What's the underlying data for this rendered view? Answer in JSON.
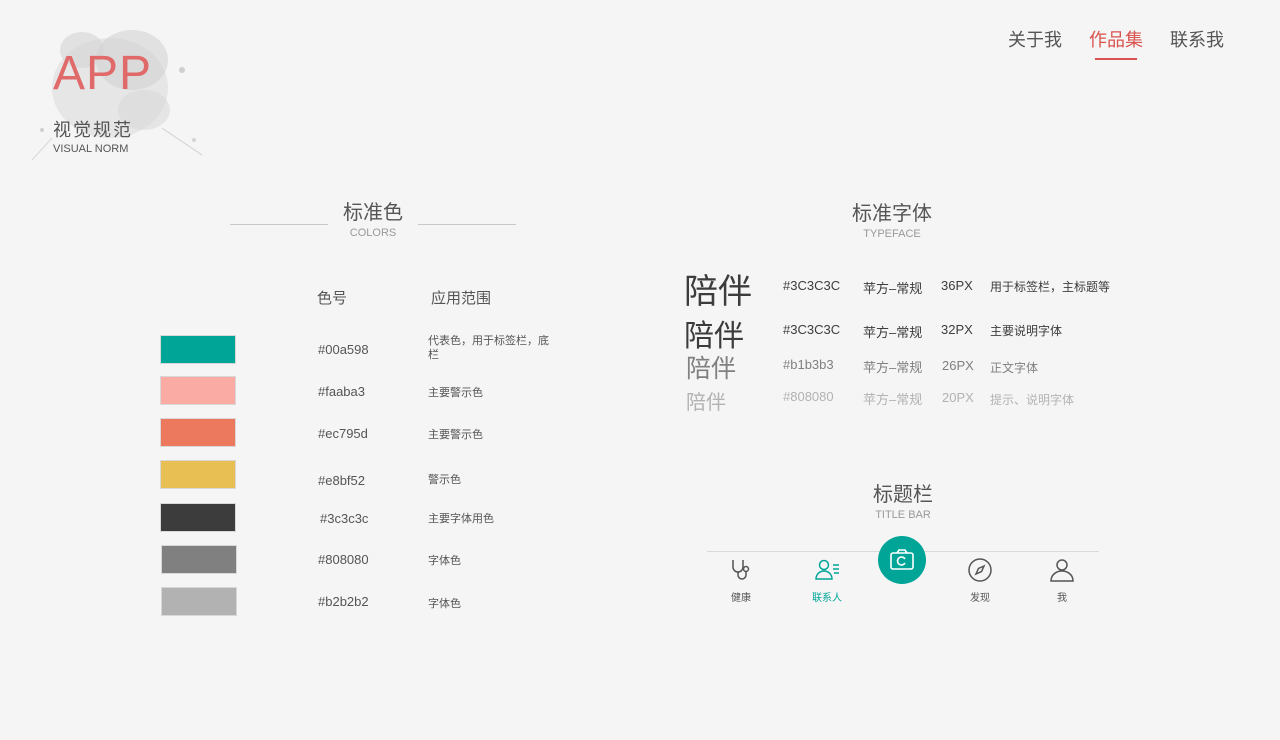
{
  "logo": {
    "title": "APP",
    "subtitle_cn": "视觉规范",
    "subtitle_en": "VISUAL NORM"
  },
  "nav": {
    "items": [
      "关于我",
      "作品集",
      "联系我"
    ],
    "active": "作品集"
  },
  "colors_section": {
    "title": "标准色",
    "subtitle": "COLORS",
    "col_code": "色号",
    "col_usage": "应用范围",
    "swatches": [
      {
        "hex": "#00a598",
        "color": "#00a598",
        "usage": "代表色，用于标签栏，底栏"
      },
      {
        "hex": "#faaba3",
        "color": "#faaba3",
        "usage": "主要警示色"
      },
      {
        "hex": "#ec795d",
        "color": "#ec795d",
        "usage": "主要警示色"
      },
      {
        "hex": "#e8bf52",
        "color": "#e8bf52",
        "usage": "警示色"
      },
      {
        "hex": "#3c3c3c",
        "color": "#3c3c3c",
        "usage": "主要字体用色"
      },
      {
        "hex": "#808080",
        "color": "#808080",
        "usage": "字体色"
      },
      {
        "hex": "#b2b2b2",
        "color": "#b2b2b2",
        "usage": "字体色"
      }
    ]
  },
  "typeface_section": {
    "title": "标准字体",
    "subtitle": "TYPEFACE",
    "rows": [
      {
        "sample": "陪伴",
        "code": "#3C3C3C",
        "font": "苹方–常规",
        "size": "36PX",
        "usage": "用于标签栏，主标题等",
        "color": "#3c3c3c"
      },
      {
        "sample": "陪伴",
        "code": "#3C3C3C",
        "font": "苹方–常规",
        "size": "32PX",
        "usage": "主要说明字体",
        "color": "#3c3c3c"
      },
      {
        "sample": "陪伴",
        "code": "#b1b3b3",
        "font": "苹方–常规",
        "size": "26PX",
        "usage": "正文字体",
        "color": "#808080"
      },
      {
        "sample": "陪伴",
        "code": "#808080",
        "font": "苹方–常规",
        "size": "20PX",
        "usage": "提示、说明字体",
        "color": "#b2b2b2"
      }
    ]
  },
  "titlebar_section": {
    "title": "标题栏",
    "subtitle": "TITLE BAR",
    "tabs": [
      {
        "label": "健康",
        "icon": "stethoscope-icon",
        "active": false
      },
      {
        "label": "联系人",
        "icon": "contacts-icon",
        "active": true
      },
      {
        "label": "",
        "icon": "camera-icon",
        "active": false
      },
      {
        "label": "发现",
        "icon": "compass-icon",
        "active": false
      },
      {
        "label": "我",
        "icon": "person-icon",
        "active": false
      }
    ],
    "accent": "#00a598"
  }
}
